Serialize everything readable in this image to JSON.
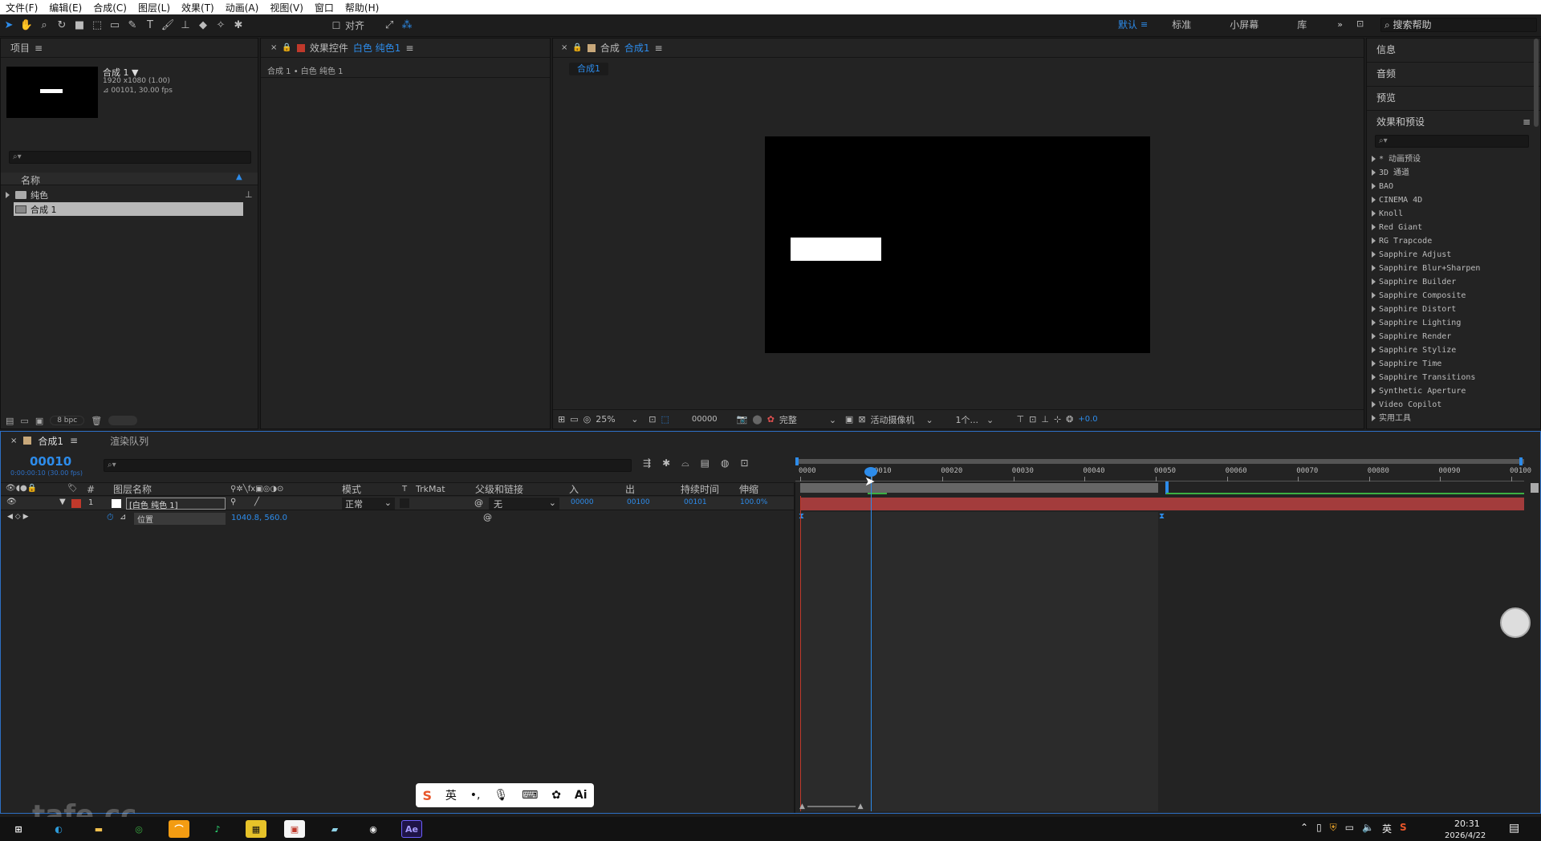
{
  "menu": [
    "文件(F)",
    "编辑(E)",
    "合成(C)",
    "图层(L)",
    "效果(T)",
    "动画(A)",
    "视图(V)",
    "窗口",
    "帮助(H)"
  ],
  "toolbar": {
    "align_label": "对齐",
    "workspaces": [
      "默认",
      "标准",
      "小屏幕",
      "库"
    ],
    "active_workspace": "默认",
    "search_help": "搜索帮助"
  },
  "project": {
    "tab": "项目",
    "comp_name": "合成 1 ▼",
    "comp_size": "1920 x1080 (1.00)",
    "comp_duration": "⊿ 00101, 30.00 fps",
    "col_name": "名称",
    "items": [
      "纯色",
      "合成 1"
    ],
    "bpc": "8 bpc"
  },
  "effect_controls": {
    "tab": "效果控件",
    "layer": "白色 纯色1",
    "breadcrumb": "合成 1 • 白色 纯色 1"
  },
  "composition": {
    "tab": "合成",
    "name": "合成1",
    "subtab": "合成1",
    "zoom": "25%",
    "timecode": "00000",
    "quality": "完整",
    "camera": "活动摄像机",
    "views": "1个...",
    "exposure": "+0.0"
  },
  "right_panels": [
    "信息",
    "音频",
    "预览"
  ],
  "effects_presets": {
    "title": "效果和预设",
    "items": [
      "* 动画预设",
      "3D 通道",
      "BAO",
      "CINEMA 4D",
      "Knoll",
      "Red Giant",
      "RG Trapcode",
      "Sapphire Adjust",
      "Sapphire Blur+Sharpen",
      "Sapphire Builder",
      "Sapphire Composite",
      "Sapphire Distort",
      "Sapphire Lighting",
      "Sapphire Render",
      "Sapphire Stylize",
      "Sapphire Time",
      "Sapphire Transitions",
      "Synthetic Aperture",
      "Video Copilot",
      "实用工具"
    ]
  },
  "timeline": {
    "tab": "合成1",
    "render_queue": "渲染队列",
    "current_time": "00010",
    "current_time_sub": "0:00:00:10 (30.00 fps)",
    "columns": {
      "num": "#",
      "layer_name": "图层名称",
      "mode": "模式",
      "t": "T",
      "trkmat": "TrkMat",
      "parent": "父级和链接",
      "in": "入",
      "out": "出",
      "duration": "持续时间",
      "stretch": "伸缩"
    },
    "layer": {
      "index": "1",
      "name": "[白色 纯色 1]",
      "mode": "正常",
      "parent": "无",
      "in": "00000",
      "out": "00100",
      "duration": "00101",
      "stretch": "100.0%"
    },
    "property": {
      "name": "位置",
      "value": "1040.8, 560.0"
    },
    "ruler": [
      "0000",
      "00010",
      "00020",
      "00030",
      "00040",
      "00050",
      "00060",
      "00070",
      "00080",
      "00090",
      "00100"
    ]
  },
  "ime": {
    "lang": "英",
    "ai": "Ai"
  },
  "watermark": "tafe.cc",
  "taskbar": {
    "time": "20:31",
    "date": "2026/4/22",
    "lang": "英"
  },
  "colors": {
    "accent": "#2d8ceb",
    "layer_bar": "#a33c3c",
    "label_red": "#c0392b"
  }
}
